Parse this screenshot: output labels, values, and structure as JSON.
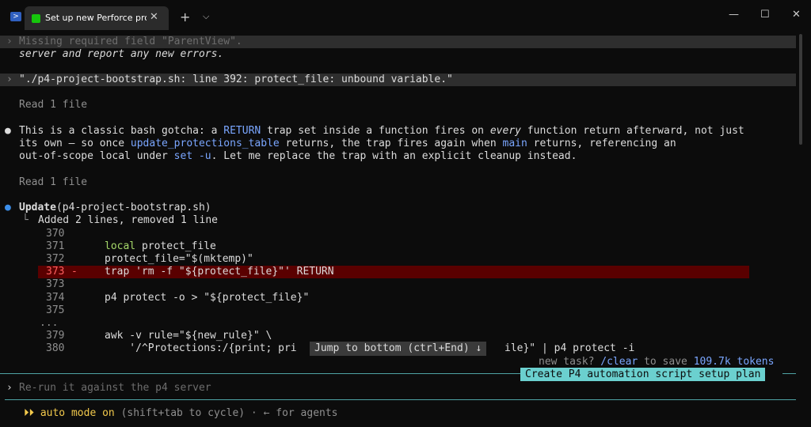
{
  "titlebar": {
    "tab_title": "Set up new Perforce proje",
    "tab_close": "✕",
    "new_tab": "+",
    "dropdown": "⌵",
    "minimize": "—",
    "maximize": "☐",
    "close": "✕"
  },
  "lines": {
    "l1_prompt": "›",
    "l1": "Missing required field \"ParentView\".",
    "l2": "server and report any new errors.",
    "l3_prompt": "›",
    "l3": "\"./p4-project-bootstrap.sh: line 392: protect_file: unbound variable.\"",
    "read1": "Read 1 file",
    "bullet": "●",
    "p1a": "This is a classic bash gotcha: a ",
    "p1_return": "RETURN",
    "p1b": " trap set inside a function fires on ",
    "p1_every": "every",
    "p1c": " function return afterward, not just",
    "p2a": "its own — so once ",
    "p2_fn": "update_protections_table",
    "p2b": " returns, the trap fires again when ",
    "p2_main": "main",
    "p2c": " returns, referencing an",
    "p3a": "out-of-scope local under ",
    "p3_setu": "set -u",
    "p3b": ". Let me replace the trap with an explicit cleanup instead.",
    "read2": "Read 1 file",
    "update_label": "Update",
    "update_arg": "(p4-project-bootstrap.sh)",
    "summary_prefix": "└",
    "summary": "Added 2 lines, removed 1 line"
  },
  "diff": [
    {
      "num": "370",
      "marker": "",
      "code": ""
    },
    {
      "num": "371",
      "marker": "",
      "code_kw": "local",
      "code": " protect_file"
    },
    {
      "num": "372",
      "marker": "",
      "code": "protect_file=\"$(mktemp)\""
    },
    {
      "num": "373",
      "marker": "-",
      "code": "trap 'rm -f \"${protect_file}\"' RETURN"
    },
    {
      "num": "373",
      "marker": "",
      "code": ""
    },
    {
      "num": "374",
      "marker": "",
      "code": "p4 protect -o > \"${protect_file}\""
    },
    {
      "num": "375",
      "marker": "",
      "code": ""
    },
    {
      "num": "...",
      "marker": "",
      "code": ""
    },
    {
      "num": "379",
      "marker": "",
      "code": "awk -v rule=\"${new_rule}\" \\"
    },
    {
      "num": "380",
      "marker": "",
      "code": "    '/^Protections:/{print; pri",
      "code_tail": "ile}\" | p4 protect -i"
    }
  ],
  "jump": "Jump to bottom (ctrl+End) ↓",
  "hint": {
    "prefix": "new task? ",
    "cmd": "/clear",
    "mid": " to save ",
    "tokens": "109.7k tokens"
  },
  "plan_badge": "Create P4 automation script setup plan",
  "input": {
    "prompt": "›",
    "placeholder": "Re-run it against the p4 server"
  },
  "footer": {
    "arrows": "⏵⏵",
    "mode": " auto mode on",
    "cycle": " (shift+tab to cycle) · ← for agents"
  }
}
